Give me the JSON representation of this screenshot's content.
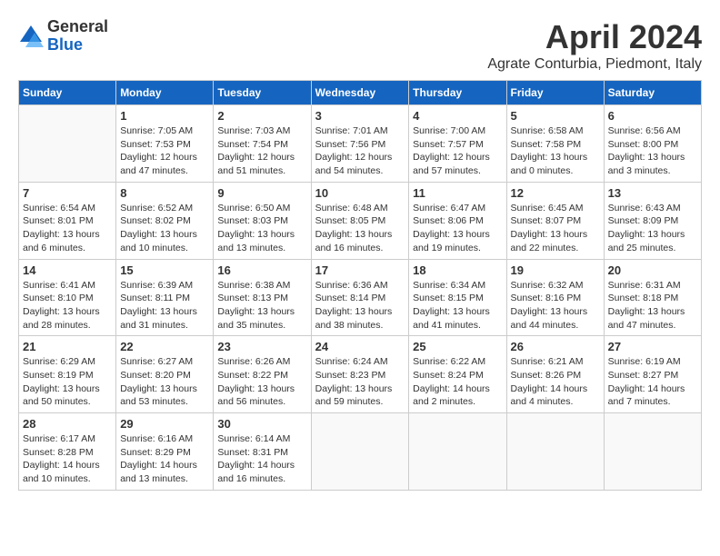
{
  "logo": {
    "general": "General",
    "blue": "Blue"
  },
  "title": "April 2024",
  "location": "Agrate Conturbia, Piedmont, Italy",
  "days": [
    "Sunday",
    "Monday",
    "Tuesday",
    "Wednesday",
    "Thursday",
    "Friday",
    "Saturday"
  ],
  "weeks": [
    [
      {
        "date": "",
        "info": ""
      },
      {
        "date": "1",
        "info": "Sunrise: 7:05 AM\nSunset: 7:53 PM\nDaylight: 12 hours\nand 47 minutes."
      },
      {
        "date": "2",
        "info": "Sunrise: 7:03 AM\nSunset: 7:54 PM\nDaylight: 12 hours\nand 51 minutes."
      },
      {
        "date": "3",
        "info": "Sunrise: 7:01 AM\nSunset: 7:56 PM\nDaylight: 12 hours\nand 54 minutes."
      },
      {
        "date": "4",
        "info": "Sunrise: 7:00 AM\nSunset: 7:57 PM\nDaylight: 12 hours\nand 57 minutes."
      },
      {
        "date": "5",
        "info": "Sunrise: 6:58 AM\nSunset: 7:58 PM\nDaylight: 13 hours\nand 0 minutes."
      },
      {
        "date": "6",
        "info": "Sunrise: 6:56 AM\nSunset: 8:00 PM\nDaylight: 13 hours\nand 3 minutes."
      }
    ],
    [
      {
        "date": "7",
        "info": "Sunrise: 6:54 AM\nSunset: 8:01 PM\nDaylight: 13 hours\nand 6 minutes."
      },
      {
        "date": "8",
        "info": "Sunrise: 6:52 AM\nSunset: 8:02 PM\nDaylight: 13 hours\nand 10 minutes."
      },
      {
        "date": "9",
        "info": "Sunrise: 6:50 AM\nSunset: 8:03 PM\nDaylight: 13 hours\nand 13 minutes."
      },
      {
        "date": "10",
        "info": "Sunrise: 6:48 AM\nSunset: 8:05 PM\nDaylight: 13 hours\nand 16 minutes."
      },
      {
        "date": "11",
        "info": "Sunrise: 6:47 AM\nSunset: 8:06 PM\nDaylight: 13 hours\nand 19 minutes."
      },
      {
        "date": "12",
        "info": "Sunrise: 6:45 AM\nSunset: 8:07 PM\nDaylight: 13 hours\nand 22 minutes."
      },
      {
        "date": "13",
        "info": "Sunrise: 6:43 AM\nSunset: 8:09 PM\nDaylight: 13 hours\nand 25 minutes."
      }
    ],
    [
      {
        "date": "14",
        "info": "Sunrise: 6:41 AM\nSunset: 8:10 PM\nDaylight: 13 hours\nand 28 minutes."
      },
      {
        "date": "15",
        "info": "Sunrise: 6:39 AM\nSunset: 8:11 PM\nDaylight: 13 hours\nand 31 minutes."
      },
      {
        "date": "16",
        "info": "Sunrise: 6:38 AM\nSunset: 8:13 PM\nDaylight: 13 hours\nand 35 minutes."
      },
      {
        "date": "17",
        "info": "Sunrise: 6:36 AM\nSunset: 8:14 PM\nDaylight: 13 hours\nand 38 minutes."
      },
      {
        "date": "18",
        "info": "Sunrise: 6:34 AM\nSunset: 8:15 PM\nDaylight: 13 hours\nand 41 minutes."
      },
      {
        "date": "19",
        "info": "Sunrise: 6:32 AM\nSunset: 8:16 PM\nDaylight: 13 hours\nand 44 minutes."
      },
      {
        "date": "20",
        "info": "Sunrise: 6:31 AM\nSunset: 8:18 PM\nDaylight: 13 hours\nand 47 minutes."
      }
    ],
    [
      {
        "date": "21",
        "info": "Sunrise: 6:29 AM\nSunset: 8:19 PM\nDaylight: 13 hours\nand 50 minutes."
      },
      {
        "date": "22",
        "info": "Sunrise: 6:27 AM\nSunset: 8:20 PM\nDaylight: 13 hours\nand 53 minutes."
      },
      {
        "date": "23",
        "info": "Sunrise: 6:26 AM\nSunset: 8:22 PM\nDaylight: 13 hours\nand 56 minutes."
      },
      {
        "date": "24",
        "info": "Sunrise: 6:24 AM\nSunset: 8:23 PM\nDaylight: 13 hours\nand 59 minutes."
      },
      {
        "date": "25",
        "info": "Sunrise: 6:22 AM\nSunset: 8:24 PM\nDaylight: 14 hours\nand 2 minutes."
      },
      {
        "date": "26",
        "info": "Sunrise: 6:21 AM\nSunset: 8:26 PM\nDaylight: 14 hours\nand 4 minutes."
      },
      {
        "date": "27",
        "info": "Sunrise: 6:19 AM\nSunset: 8:27 PM\nDaylight: 14 hours\nand 7 minutes."
      }
    ],
    [
      {
        "date": "28",
        "info": "Sunrise: 6:17 AM\nSunset: 8:28 PM\nDaylight: 14 hours\nand 10 minutes."
      },
      {
        "date": "29",
        "info": "Sunrise: 6:16 AM\nSunset: 8:29 PM\nDaylight: 14 hours\nand 13 minutes."
      },
      {
        "date": "30",
        "info": "Sunrise: 6:14 AM\nSunset: 8:31 PM\nDaylight: 14 hours\nand 16 minutes."
      },
      {
        "date": "",
        "info": ""
      },
      {
        "date": "",
        "info": ""
      },
      {
        "date": "",
        "info": ""
      },
      {
        "date": "",
        "info": ""
      }
    ]
  ]
}
